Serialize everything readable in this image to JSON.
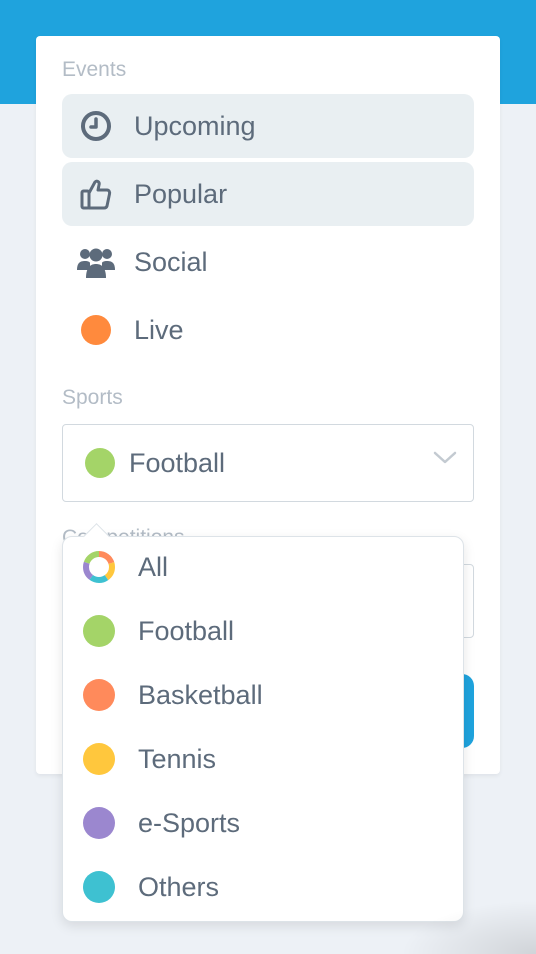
{
  "events": {
    "section_label": "Events",
    "items": [
      {
        "label": "Upcoming",
        "icon": "clock-icon",
        "active": true
      },
      {
        "label": "Popular",
        "icon": "thumbs-up-icon",
        "active": true
      },
      {
        "label": "Social",
        "icon": "users-icon",
        "active": false
      },
      {
        "label": "Live",
        "icon": "live-dot-icon",
        "active": false,
        "color": "#ff8a3d"
      }
    ]
  },
  "sports": {
    "section_label": "Sports",
    "selected": {
      "label": "Football",
      "color": "#a4d468"
    },
    "options": [
      {
        "label": "All",
        "icon": "all-sports-icon"
      },
      {
        "label": "Football",
        "color": "#a4d468"
      },
      {
        "label": "Basketball",
        "color": "#ff8a5b"
      },
      {
        "label": "Tennis",
        "color": "#ffc73d"
      },
      {
        "label": "e-Sports",
        "color": "#9b87cf"
      },
      {
        "label": "Others",
        "color": "#3ec1d1"
      }
    ]
  },
  "competitions": {
    "section_label": "Competitions"
  },
  "colors": {
    "brand": "#1fa3dd",
    "text": "#5d6b7b",
    "muted": "#b3bcc6",
    "active_bg": "#e9eff2"
  }
}
